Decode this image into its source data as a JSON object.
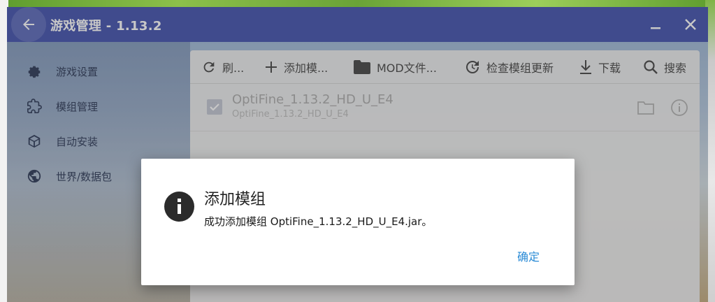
{
  "window": {
    "title": "游戏管理 - 1.13.2"
  },
  "titlebar_icons": {
    "back": "arrow-left-icon",
    "minimize": "minimize-icon",
    "close": "close-icon"
  },
  "sidebar": {
    "items": [
      {
        "label": "游戏设置",
        "icon": "gear-icon"
      },
      {
        "label": "模组管理",
        "icon": "puzzle-icon"
      },
      {
        "label": "自动安装",
        "icon": "cube-icon"
      },
      {
        "label": "世界/数据包",
        "icon": "globe-icon"
      }
    ]
  },
  "toolbar": {
    "buttons": [
      {
        "label": "刷...",
        "icon": "refresh-icon"
      },
      {
        "label": "添加模...",
        "icon": "plus-icon"
      },
      {
        "label": "MOD文件...",
        "icon": "folder-icon"
      },
      {
        "label": "检查模组更新",
        "icon": "update-icon"
      },
      {
        "label": "下载",
        "icon": "download-icon"
      },
      {
        "label": "搜索",
        "icon": "search-icon"
      }
    ]
  },
  "mods": [
    {
      "name": "OptiFine_1.13.2_HD_U_E4",
      "file": "OptiFine_1.13.2_HD_U_E4",
      "enabled": true
    }
  ],
  "dialog": {
    "title": "添加模组",
    "message": "成功添加模组 OptiFine_1.13.2_HD_U_E4.jar。",
    "ok_label": "确定",
    "icon": "info-icon"
  },
  "colors": {
    "titlebar": "#5361b5",
    "accent": "#2a8bd6"
  }
}
